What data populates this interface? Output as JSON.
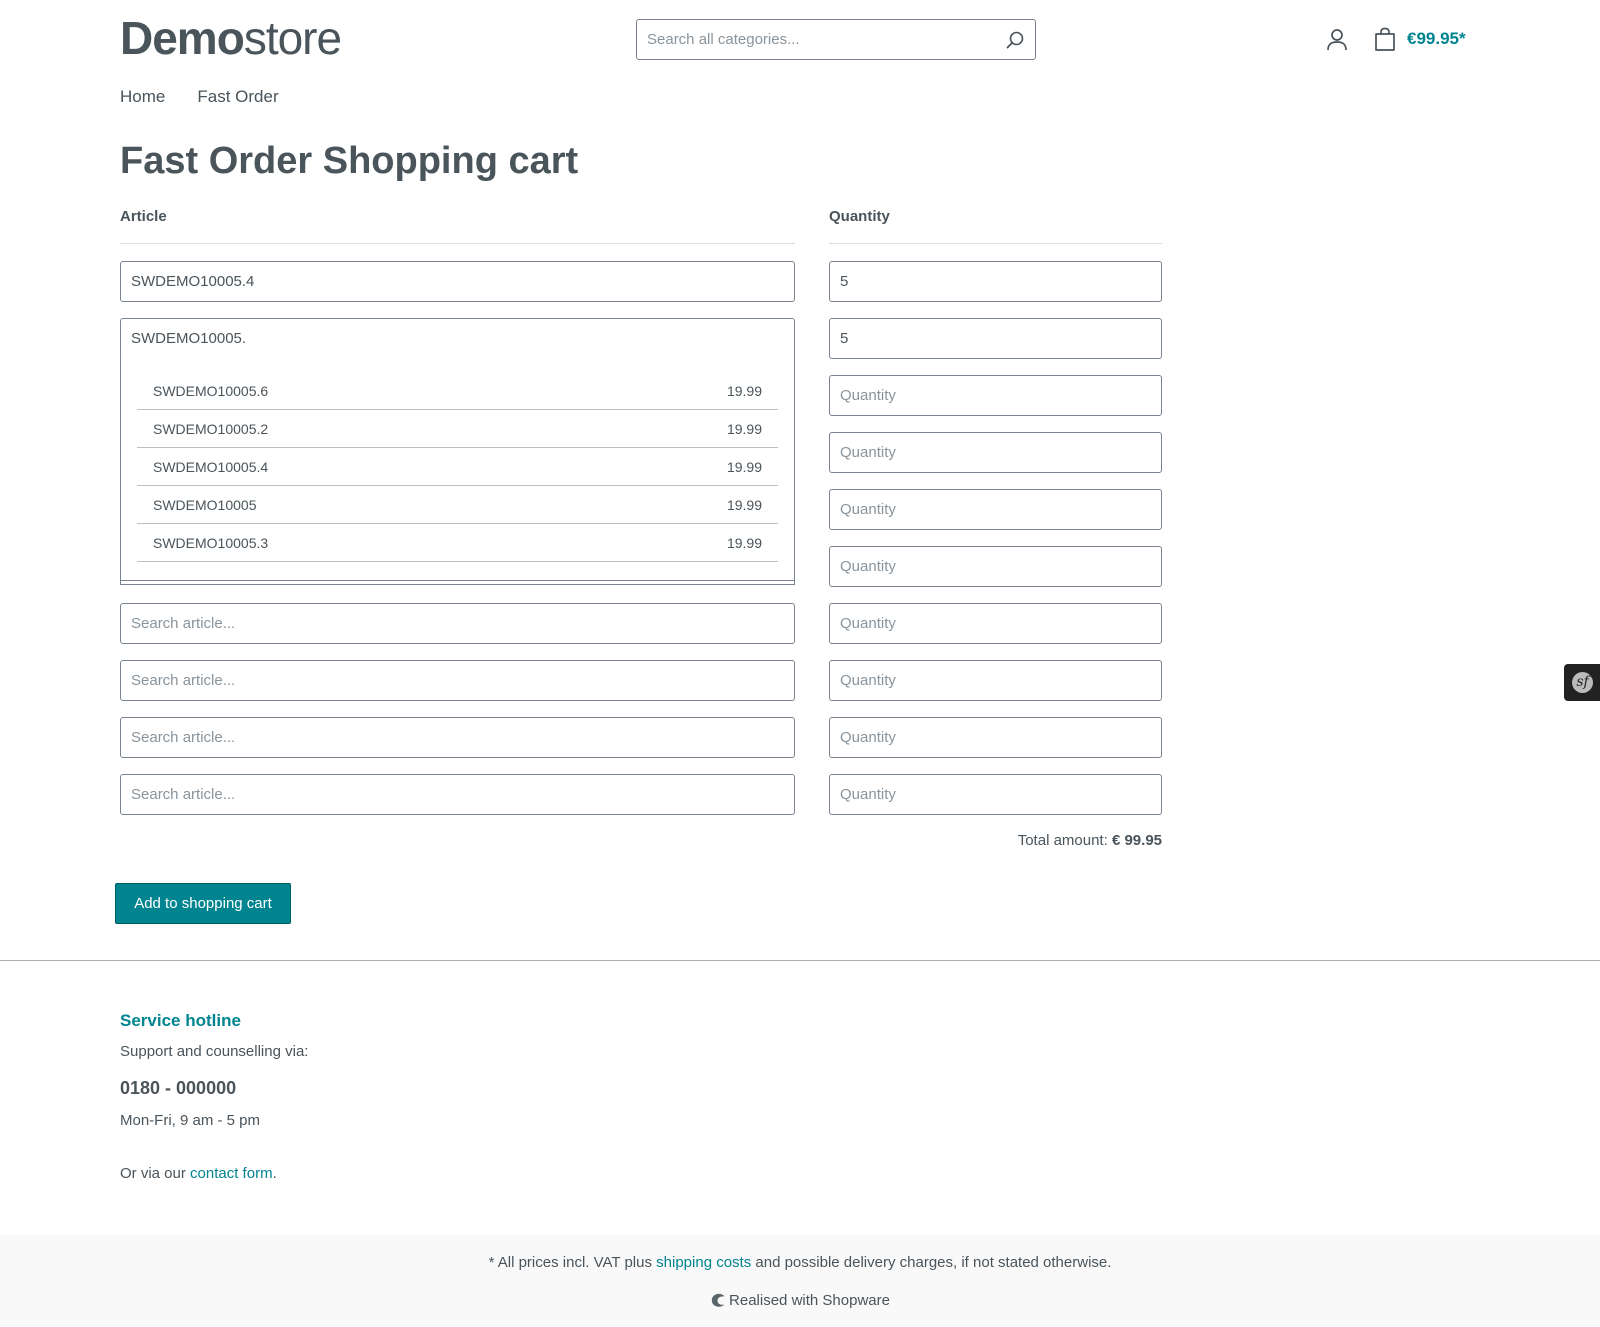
{
  "header": {
    "logo_bold": "Demo",
    "logo_light": "store",
    "search_placeholder": "Search all categories...",
    "cart_total": "€99.95*"
  },
  "nav": {
    "items": [
      "Home",
      "Fast Order"
    ]
  },
  "page": {
    "title": "Fast Order Shopping cart",
    "article_header": "Article",
    "quantity_header": "Quantity"
  },
  "rows": [
    {
      "article": "SWDEMO10005.4",
      "quantity": "5"
    },
    {
      "article": "SWDEMO10005.",
      "quantity": "5"
    },
    {
      "article": "",
      "quantity": ""
    },
    {
      "article": "",
      "quantity": ""
    },
    {
      "article": "",
      "quantity": ""
    },
    {
      "article": "",
      "quantity": ""
    },
    {
      "article": "",
      "quantity": ""
    },
    {
      "article": "",
      "quantity": ""
    },
    {
      "article": "",
      "quantity": ""
    },
    {
      "article": "",
      "quantity": ""
    }
  ],
  "placeholders": {
    "article": "Search article...",
    "quantity": "Quantity"
  },
  "suggestions": [
    {
      "sku": "SWDEMO10005.6",
      "price": "19.99"
    },
    {
      "sku": "SWDEMO10005.2",
      "price": "19.99"
    },
    {
      "sku": "SWDEMO10005.4",
      "price": "19.99"
    },
    {
      "sku": "SWDEMO10005",
      "price": "19.99"
    },
    {
      "sku": "SWDEMO10005.3",
      "price": "19.99"
    }
  ],
  "summary": {
    "total_label": "Total amount:",
    "total_value": "€ 99.95",
    "add_button": "Add to shopping cart"
  },
  "footer": {
    "hotline_title": "Service hotline",
    "hotline_sub": "Support and counselling via:",
    "phone": "0180 - 000000",
    "hours": "Mon-Fri, 9 am - 5 pm",
    "contact_prefix": "Or via our ",
    "contact_link": "contact form",
    "contact_suffix": ".",
    "vat_prefix": "* All prices incl. VAT plus ",
    "vat_link": "shipping costs",
    "vat_suffix": " and possible delivery charges, if not stated otherwise.",
    "realised": "Realised with Shopware"
  },
  "colors": {
    "brand": "#008490",
    "text": "#4a545b"
  },
  "icons": [
    "search-icon",
    "account-icon",
    "cart-icon",
    "shopware-icon",
    "symfony-icon"
  ]
}
